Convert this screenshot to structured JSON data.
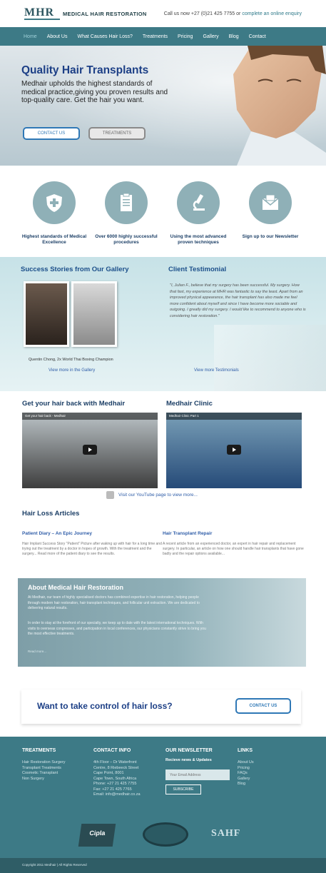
{
  "header": {
    "logo_mark": "MHR",
    "brand": "MEDICAL HAIR RESTORATION",
    "call_prefix": "Call us now +27 (0)21 425 7755",
    "call_or": " or ",
    "enquiry": "complete an online enquiry"
  },
  "nav": [
    "Home",
    "About Us",
    "What Causes Hair Loss?",
    "Treatments",
    "Pricing",
    "Gallery",
    "Blog",
    "Contact"
  ],
  "hero": {
    "title": "Quality Hair Transplants",
    "text": "Medhair upholds the highest standards of medical practice,giving you proven results and top-quality care. Get the hair you want.",
    "contact_label": "CONTACT US",
    "treatments_label": "TREATMENTS"
  },
  "features": [
    {
      "label": "Highest standards of Medical Excellence",
      "icon": "medical-shield-icon"
    },
    {
      "label": "Over 6000 highly successful procedures",
      "icon": "clipboard-icon"
    },
    {
      "label": "Using the most advanced proven techniques",
      "icon": "microscope-icon"
    },
    {
      "label": "Sign up to our Newsletter",
      "icon": "newsletter-icon"
    }
  ],
  "stories": {
    "title": "Success Stories from Our Gallery",
    "caption": "Quentin Chong, 2x World Thai Boxing Champion",
    "gallery_link": "View more in the Gallery",
    "testimonial_title": "Client Testimonial",
    "testimonial": "\"I, Julian F., believe that my surgery has been successful. My surgery. How that fast, my experience at MHR was fantastic to say the least. Apart from an improved physical appearance, the hair transplant has also made me feel more confident about myself and since I have become more sociable and outgoing. I greatly did my surgery. I would like to recommend to anyone who is considering hair restoration.\"",
    "testimonial_link": "View more Testimonials"
  },
  "videos": {
    "left_title": "Get your hair back with Medhair",
    "right_title": "Medhair Clinic",
    "left_video": "Get your hair back - Medhair",
    "right_video": "Medhair Clinic Part 1",
    "youtube_link": "Visit our YouTube page to view more..."
  },
  "articles": {
    "title": "Hair Loss Articles",
    "items": [
      {
        "title": "Patient Diary – An Epic Journey",
        "body": "Hair Implant Success Story \"Patient\" Picture after waking up with hair for a long time and trying out the treatment by a doctor in hopes of growth. With the treatment and the surgery... Read more of the patient diary to see the results."
      },
      {
        "title": "Hair Transplant Repair",
        "body": "A recent article from an experienced doctor, an expert in hair repair and replacement surgery. In particular, an article on how one should handle hair transplants that have gone badly and the repair options available..."
      }
    ]
  },
  "about": {
    "title": "About Medical Hair Restoration",
    "p1": "At Medhair, our team of highly specialised doctors has combined expertise in hair restoration, helping people through modern hair restoration, hair transplant techniques, and follicular unit extraction. We are dedicated to delivering natural results.",
    "p2": "In order to stay at the forefront of our specialty, we keep up to date with the latest international techniques. With visits to overseas congresses, and participation in local conferences, our physicians constantly strive to bring you the most effective treatments.",
    "more": "Read more..."
  },
  "cta": {
    "title": "Want to take control of hair loss?",
    "button": "CONTACT US"
  },
  "footer": {
    "treatments_title": "TREATMENTS",
    "treatments": [
      "Hair Restoration Surgery",
      "Transplant Treatments",
      "Cosmetic Transplant",
      "Non Surgery"
    ],
    "contact_title": "CONTACT INFO",
    "contact": [
      "4th Floor – Dr Waterfront",
      "Centre, 8 Riebeeck Street",
      "Cape Point, 8001",
      "Cape Town, South Africa",
      "Phone: +27 21 425 7755",
      "Fax: +27 21 425 7765",
      "Email: info@medhair.co.za"
    ],
    "newsletter_title": "OUR NEWSLETTER",
    "newsletter_sub": "Recieve news & Updates",
    "email_placeholder": "Your Email Address",
    "subscribe": "SUBSCRIBE",
    "links_title": "LINKS",
    "links": [
      "About Us",
      "Pricing",
      "FAQs",
      "Gallery",
      "Blog"
    ],
    "sahf": "SAHF",
    "cipla": "Cipla",
    "copyright": "Copyright 2011 Medhair  |  All Rights Reserved"
  }
}
